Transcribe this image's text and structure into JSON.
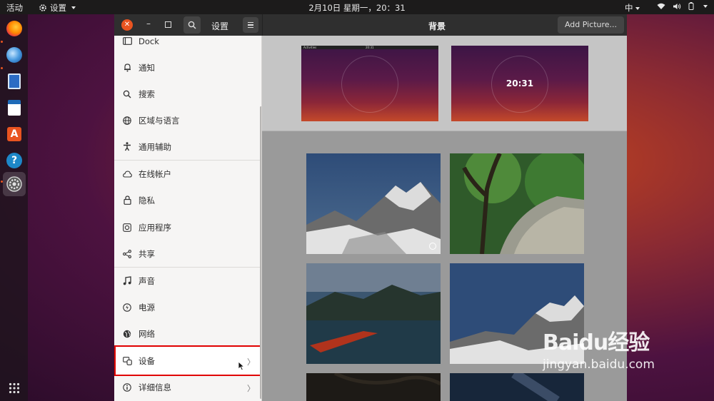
{
  "topbar": {
    "activities": "活动",
    "app_menu": "设置",
    "clock": "2月10日 星期一，20：31",
    "input_method": "中"
  },
  "dock": {
    "apps": [
      {
        "name": "firefox-icon",
        "color": "#e66000"
      },
      {
        "name": "thunderbird-icon",
        "color": "#2f7bd4"
      },
      {
        "name": "writer-icon",
        "color": "#2c6cc4"
      },
      {
        "name": "document-icon",
        "color": "#1e6bb8"
      },
      {
        "name": "software-center-icon",
        "color": "#e95420"
      },
      {
        "name": "help-icon",
        "color": "#1d87c8"
      },
      {
        "name": "settings-icon",
        "color": "#888888"
      }
    ],
    "show_apps_icon": "grid-icon"
  },
  "window": {
    "left_title": "设置",
    "title": "背景",
    "add_picture_label": "Add Picture...",
    "lock_screen_time": "20:31",
    "preview_bar_left": "Activities",
    "preview_bar_center": "20:31"
  },
  "sidebar": {
    "items": [
      {
        "label": "Dock",
        "icon": "dock-icon"
      },
      {
        "label": "通知",
        "icon": "bell-icon"
      },
      {
        "label": "搜索",
        "icon": "search-icon"
      },
      {
        "label": "区域与语言",
        "icon": "globe-icon"
      },
      {
        "label": "通用辅助",
        "icon": "accessibility-icon"
      },
      {
        "label": "在线帐户",
        "icon": "cloud-icon"
      },
      {
        "label": "隐私",
        "icon": "lock-icon"
      },
      {
        "label": "应用程序",
        "icon": "apps-icon"
      },
      {
        "label": "共享",
        "icon": "share-icon"
      },
      {
        "label": "声音",
        "icon": "music-note-icon"
      },
      {
        "label": "电源",
        "icon": "power-icon"
      },
      {
        "label": "网络",
        "icon": "network-icon"
      },
      {
        "label": "设备",
        "icon": "devices-icon"
      },
      {
        "label": "详细信息",
        "icon": "info-icon"
      }
    ]
  },
  "watermark": {
    "logo": "Baidu经验",
    "url": "jingyan.baidu.com"
  },
  "colors": {
    "accent": "#e95420",
    "highlight_border": "#e00000",
    "headerbar": "#2f2f2f"
  }
}
